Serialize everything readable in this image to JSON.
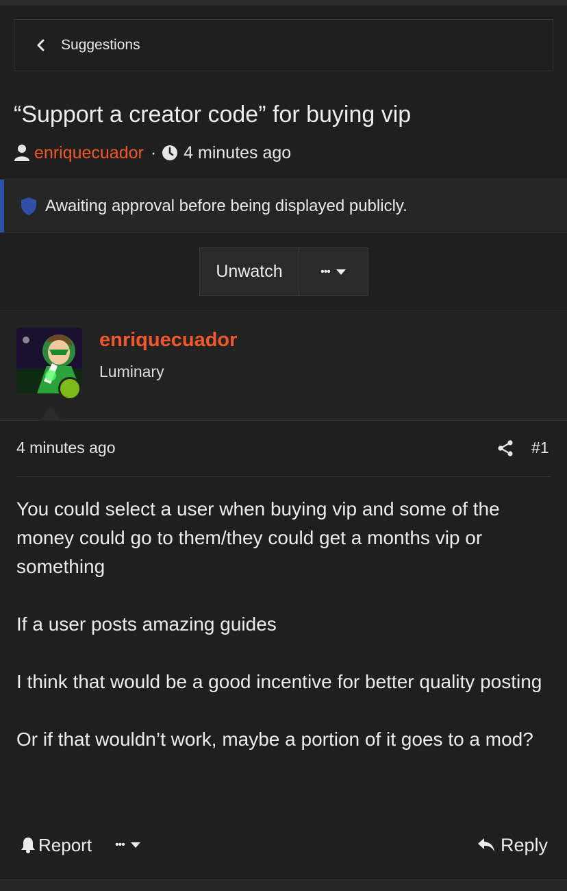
{
  "breadcrumb": {
    "label": "Suggestions"
  },
  "thread": {
    "title": "“Support a creator code” for buying vip",
    "author": "enriquecuador",
    "separator": "·",
    "time": "4 minutes ago"
  },
  "notice": {
    "text": "Awaiting approval before being displayed publicly."
  },
  "actions": {
    "unwatch": "Unwatch",
    "more": "•••"
  },
  "post": {
    "username": "enriquecuador",
    "user_title": "Luminary",
    "time": "4 minutes ago",
    "number": "#1",
    "paragraphs": [
      "You could select a user when buying vip and some of the money could go to them/they could get a months vip or something",
      "If a user posts amazing guides",
      "I think that would be a good incentive for better quality posting",
      "Or if that wouldn’t work, maybe a portion of it goes to a mod?"
    ],
    "report": "Report",
    "more": "•••",
    "reply": "Reply"
  },
  "colors": {
    "background": "#1f1f1f",
    "accent_orange": "#f0582b",
    "notice_bar": "#2f4fa8",
    "online_dot": "#7dbb19"
  },
  "icons": [
    "chevron-left-icon",
    "user-icon",
    "clock-icon",
    "shield-icon",
    "caret-down-icon",
    "share-icon",
    "bell-icon",
    "reply-icon"
  ]
}
